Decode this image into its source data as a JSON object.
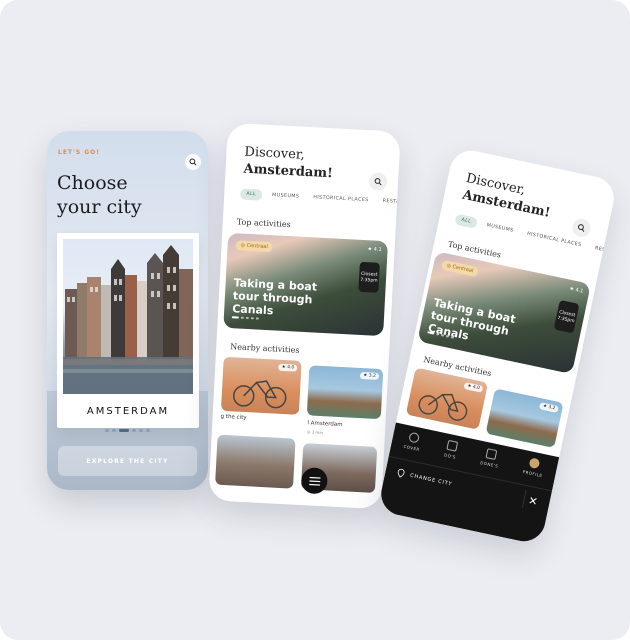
{
  "screen1": {
    "label": "LET'S GO!",
    "title_line1": "Choose",
    "title_line2": "your city",
    "city": "AMSTERDAM",
    "explore": "EXPLORE THE CITY"
  },
  "discover": {
    "line1": "Discover,",
    "line2": "Amsterdam!",
    "chips": [
      "ALL",
      "MUSEUMS",
      "HISTORICAL PLACES",
      "RESTAURA"
    ],
    "top_activities": "Top activities",
    "nearby_activities": "Nearby activities",
    "featured": {
      "tag": "Centraal",
      "rating": "4.1",
      "closest_label": "Closest",
      "closest_time": "7:35pm",
      "title": "Taking a boat tour through Canals"
    },
    "nearby": [
      {
        "rating": "4.0",
        "caption": "g the city"
      },
      {
        "rating": "3.2",
        "caption": "l Amsterdam",
        "sub": "3 min"
      }
    ]
  },
  "menu": {
    "items": [
      "COVER",
      "DO'S",
      "DONE'S",
      "PROFILE"
    ],
    "change_city": "CHANGE CITY"
  },
  "colors": {
    "accent": "#d98d54",
    "chip": "#dbe9e3",
    "dark": "#141414"
  }
}
